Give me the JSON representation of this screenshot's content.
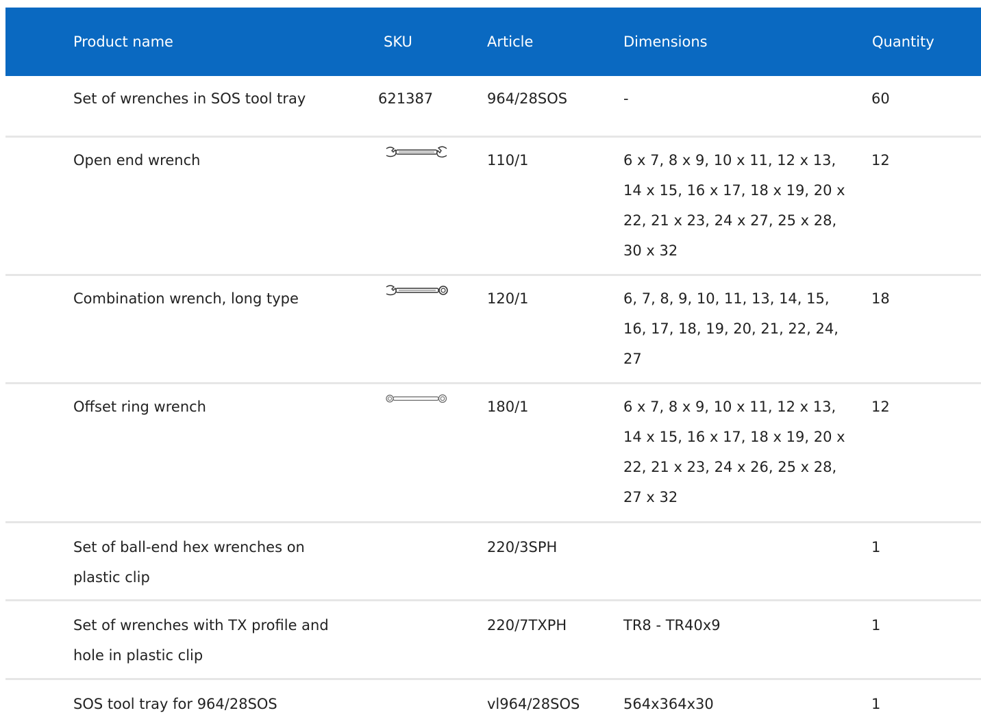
{
  "table": {
    "headers": {
      "product_name": "Product name",
      "sku": "SKU",
      "article": "Article",
      "dimensions": "Dimensions",
      "quantity": "Quantity"
    },
    "header_bg": "#0a69c1",
    "rows": [
      {
        "name": "Set of wrenches in SOS tool tray",
        "sku": "621387",
        "article": "964/28SOS",
        "dimensions": "-",
        "quantity": "60"
      },
      {
        "name": "Open end wrench",
        "sku_icon": "open-end-wrench-icon",
        "article": "110/1",
        "dimensions": "6 x 7, 8 x 9, 10 x 11, 12 x 13, 14 x 15, 16 x 17, 18 x 19, 20 x 22, 21 x 23, 24 x 27, 25 x 28, 30 x 32",
        "quantity": "12"
      },
      {
        "name": "Combination wrench, long type",
        "sku_icon": "combination-wrench-icon",
        "article": "120/1",
        "dimensions": "6, 7, 8, 9, 10, 11, 13, 14, 15, 16, 17, 18, 19, 20, 21, 22, 24, 27",
        "quantity": "18"
      },
      {
        "name": "Offset ring wrench",
        "sku_icon": "ring-wrench-icon",
        "article": "180/1",
        "dimensions": "6 x 7, 8 x 9, 10 x 11, 12 x 13, 14 x 15, 16 x 17, 18 x 19, 20 x 22, 21 x 23, 24 x 26, 25 x 28, 27 x 32",
        "quantity": "12"
      },
      {
        "name": "Set of ball-end hex wrenches on plastic clip",
        "article": "220/3SPH",
        "dimensions": "",
        "quantity": "1"
      },
      {
        "name": "Set of wrenches with TX profile and hole in plastic clip",
        "article": "220/7TXPH",
        "dimensions": "TR8 - TR40x9",
        "quantity": "1"
      },
      {
        "name": "SOS tool tray for 964/28SOS",
        "article": "vl964/28SOS",
        "dimensions": "564x364x30",
        "quantity": "1"
      }
    ]
  }
}
